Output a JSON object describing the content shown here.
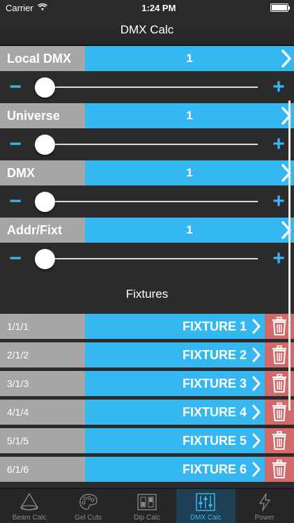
{
  "statusbar": {
    "carrier": "Carrier",
    "time": "1:24 PM"
  },
  "navbar": {
    "title": "DMX Calc"
  },
  "params": [
    {
      "label": "Local DMX",
      "value": "1"
    },
    {
      "label": "Universe",
      "value": "1"
    },
    {
      "label": "DMX",
      "value": "1"
    },
    {
      "label": "Addr/Fixt",
      "value": "1"
    }
  ],
  "slider": {
    "minus": "−",
    "plus": "+"
  },
  "fixtures_header": "Fixtures",
  "fixtures": [
    {
      "addr": "1/1/1",
      "name": "FIXTURE 1"
    },
    {
      "addr": "2/1/2",
      "name": "FIXTURE 2"
    },
    {
      "addr": "3/1/3",
      "name": "FIXTURE 3"
    },
    {
      "addr": "4/1/4",
      "name": "FIXTURE 4"
    },
    {
      "addr": "5/1/5",
      "name": "FIXTURE 5"
    },
    {
      "addr": "6/1/6",
      "name": "FIXTURE 6"
    }
  ],
  "tabs": [
    {
      "label": "Beam Calc",
      "icon": "cone-icon"
    },
    {
      "label": "Gel Cuts",
      "icon": "palette-icon"
    },
    {
      "label": "Dip Calc",
      "icon": "dip-switch-icon"
    },
    {
      "label": "DMX Calc",
      "icon": "sliders-icon"
    },
    {
      "label": "Power",
      "icon": "lightning-icon"
    }
  ],
  "colors": {
    "accent": "#35b8f2",
    "label_bg": "#a6a6a6",
    "delete_bg": "#d26a6a",
    "background": "#2b2b2b"
  }
}
